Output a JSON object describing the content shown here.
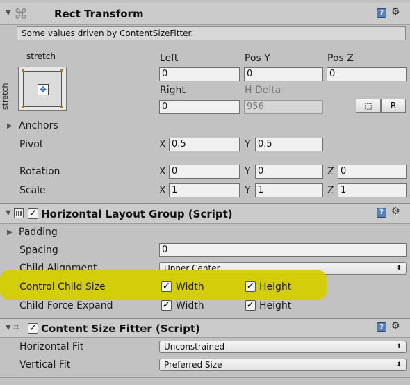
{
  "rect_transform": {
    "title": "Rect Transform",
    "note": "Some values driven by ContentSizeFitter.",
    "anchor_preset_top": "stretch",
    "anchor_preset_side": "stretch",
    "labels": {
      "left": "Left",
      "pos_y": "Pos Y",
      "pos_z": "Pos Z",
      "right": "Right",
      "h_delta": "H Delta"
    },
    "values": {
      "left": "0",
      "pos_y": "0",
      "pos_z": "0",
      "right": "0",
      "h_delta": "956"
    },
    "blueprint_button": "⬚",
    "raw_button": "R",
    "anchors_label": "Anchors",
    "pivot": {
      "label": "Pivot",
      "x": "0.5",
      "y": "0.5"
    },
    "rotation": {
      "label": "Rotation",
      "x": "0",
      "y": "0",
      "z": "0"
    },
    "scale": {
      "label": "Scale",
      "x": "1",
      "y": "1",
      "z": "1"
    },
    "axes": {
      "x": "X",
      "y": "Y",
      "z": "Z"
    }
  },
  "horizontal_layout_group": {
    "title": "Horizontal Layout Group (Script)",
    "enabled": true,
    "padding_label": "Padding",
    "spacing": {
      "label": "Spacing",
      "value": "0"
    },
    "child_alignment": {
      "label": "Child Alignment",
      "value": "Upper Center"
    },
    "control_child_size": {
      "label": "Control Child Size",
      "width_label": "Width",
      "width": true,
      "height_label": "Height",
      "height": true
    },
    "child_force_expand": {
      "label": "Child Force Expand",
      "width_label": "Width",
      "width": true,
      "height_label": "Height",
      "height": true
    }
  },
  "content_size_fitter": {
    "title": "Content Size Fitter (Script)",
    "enabled": true,
    "horizontal_fit": {
      "label": "Horizontal Fit",
      "value": "Unconstrained"
    },
    "vertical_fit": {
      "label": "Vertical Fit",
      "value": "Preferred Size"
    }
  },
  "colors": {
    "highlight": "#d4cd00",
    "background": "#c2c2c2",
    "icon_blue": "#5a7fb5"
  },
  "icons": {
    "help": "help-book-icon",
    "settings": "gear-icon",
    "foldout": "triangle-icon"
  }
}
